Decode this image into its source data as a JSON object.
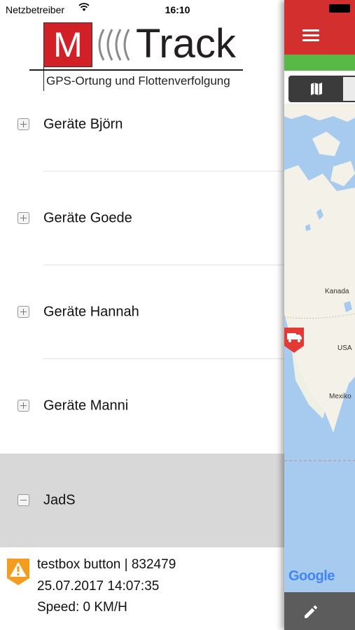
{
  "status_bar": {
    "carrier": "Netzbetreiber",
    "time": "16:10"
  },
  "logo": {
    "letter": "M",
    "name": "Track",
    "tagline": "GPS-Ortung und Flottenverfolgung"
  },
  "groups": [
    {
      "label": "Geräte Björn",
      "expanded": false
    },
    {
      "label": "Geräte Goede",
      "expanded": false
    },
    {
      "label": "Geräte Hannah",
      "expanded": false
    },
    {
      "label": "Geräte Manni",
      "expanded": false
    },
    {
      "label": "JadS",
      "expanded": true
    }
  ],
  "device": {
    "name_line": "testbox button | 832479",
    "timestamp": "25.07.2017 14:07:35",
    "speed": "Speed: 0 KM/H",
    "icon": "warning-icon"
  },
  "map": {
    "labels": {
      "canada": "Kanada",
      "usa": "USA",
      "mexico": "Mexiko"
    },
    "attribution": "Google",
    "marker_icon": "truck-icon"
  },
  "icons": {
    "menu": "menu-icon",
    "map_toggle": "map-icon",
    "edit": "pencil-icon"
  },
  "colors": {
    "header_red": "#d32f2f",
    "status_green": "#58b947",
    "active_group": "#d8d8d8",
    "warning_orange": "#f39c1f"
  }
}
